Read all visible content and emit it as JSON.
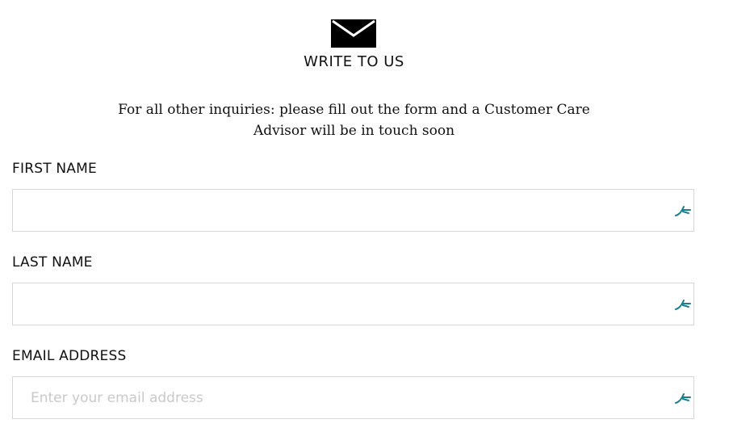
{
  "header": {
    "icon": "envelope-icon",
    "title": "WRITE TO US"
  },
  "intro": {
    "text": "For all other inquiries: please fill out the form and a Customer Care Advisor will be in touch soon"
  },
  "form": {
    "fields": [
      {
        "label": "FIRST NAME",
        "value": "",
        "placeholder": ""
      },
      {
        "label": "LAST NAME",
        "value": "",
        "placeholder": ""
      },
      {
        "label": "EMAIL ADDRESS",
        "value": "",
        "placeholder": "Enter your email address"
      }
    ],
    "autofill_icon": "autofill-icon",
    "autofill_icon_color": "#1a7f8a"
  }
}
